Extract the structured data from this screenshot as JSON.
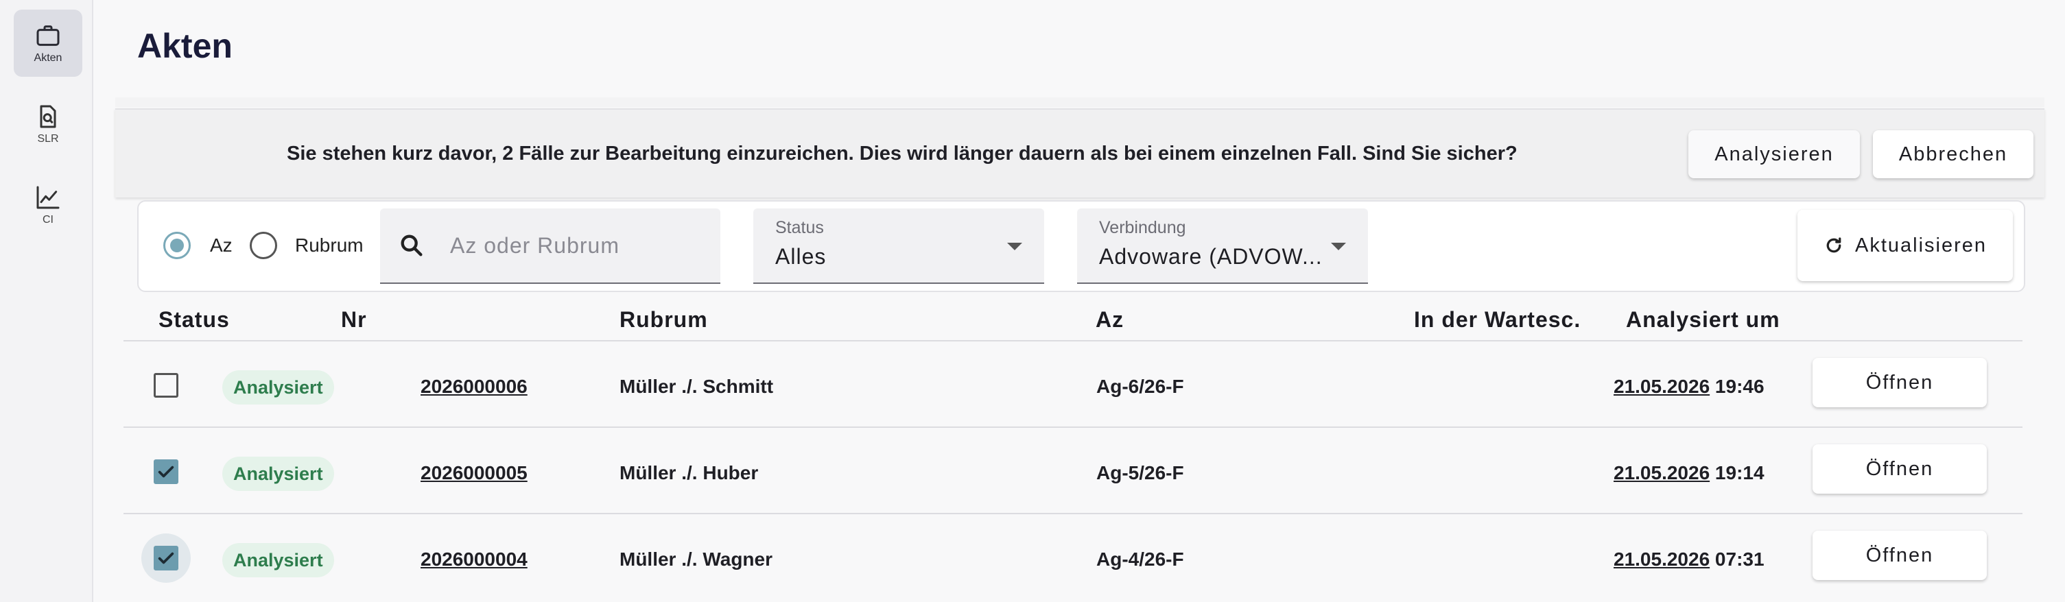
{
  "sidebar": {
    "items": [
      {
        "label": "Akten",
        "icon": "briefcase-icon",
        "active": true
      },
      {
        "label": "SLR",
        "icon": "document-search-icon",
        "active": false
      },
      {
        "label": "CI",
        "icon": "line-chart-icon",
        "active": false
      }
    ]
  },
  "page": {
    "title": "Akten"
  },
  "banner": {
    "message": "Sie stehen kurz davor, 2 Fälle zur Bearbeitung einzureichen. Dies wird länger dauern als bei einem einzelnen Fall. Sind Sie sicher?",
    "analyze_label": "Analysieren",
    "cancel_label": "Abbrechen"
  },
  "filter": {
    "radio_az": "Az",
    "radio_rubrum": "Rubrum",
    "radio_selected": "Az",
    "search_placeholder": "Az oder Rubrum",
    "search_value": "",
    "status_label": "Status",
    "status_value": "Alles",
    "connection_label": "Verbindung",
    "connection_value": "Advoware (ADVOW...",
    "refresh_label": "Aktualisieren"
  },
  "table": {
    "headers": [
      "Status",
      "Nr",
      "Rubrum",
      "Az",
      "In der Wartesc.",
      "Analysiert um"
    ],
    "rows": [
      {
        "checked": false,
        "status": "Analysiert",
        "nr": "2026000006",
        "rubrum": "Müller ./. Schmitt",
        "az": "Ag-6/26-F",
        "queue": "",
        "date": "21.05.2026",
        "time": "19:46",
        "open_label": "Öffnen"
      },
      {
        "checked": true,
        "status": "Analysiert",
        "nr": "2026000005",
        "rubrum": "Müller ./. Huber",
        "az": "Ag-5/26-F",
        "queue": "",
        "date": "21.05.2026",
        "time": "19:14",
        "open_label": "Öffnen"
      },
      {
        "checked": true,
        "status": "Analysiert",
        "nr": "2026000004",
        "rubrum": "Müller ./. Wagner",
        "az": "Ag-4/26-F",
        "queue": "",
        "date": "21.05.2026",
        "time": "07:31",
        "open_label": "Öffnen"
      }
    ]
  },
  "colors": {
    "accent": "#6c9cae",
    "chip_bg": "#e5f3ea",
    "chip_text": "#2e7d4d",
    "title": "#1a1c3a"
  }
}
